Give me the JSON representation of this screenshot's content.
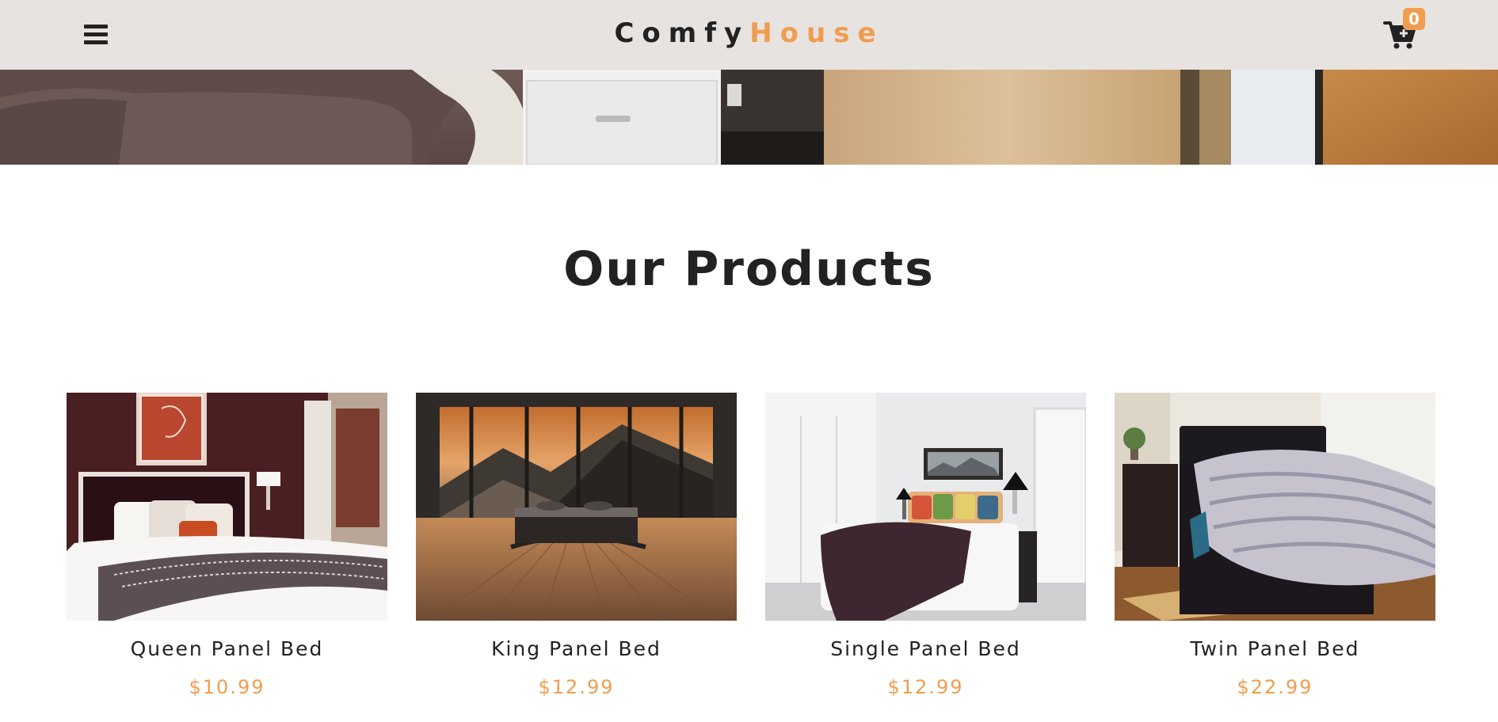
{
  "navbar": {
    "logo_first": "Comfy",
    "logo_second": "House",
    "cart_count": "0",
    "menu_icon": "hamburger-menu-icon",
    "cart_icon": "shopping-cart-icon"
  },
  "colors": {
    "accent": "#f09d51",
    "navbar_bg": "#e7e3e0",
    "text": "#222222"
  },
  "products_section": {
    "title": "Our Products",
    "items": [
      {
        "name": "Queen Panel Bed",
        "price": "$10.99"
      },
      {
        "name": "King Panel Bed",
        "price": "$12.99"
      },
      {
        "name": "Single Panel Bed",
        "price": "$12.99"
      },
      {
        "name": "Twin Panel Bed",
        "price": "$22.99"
      }
    ]
  }
}
